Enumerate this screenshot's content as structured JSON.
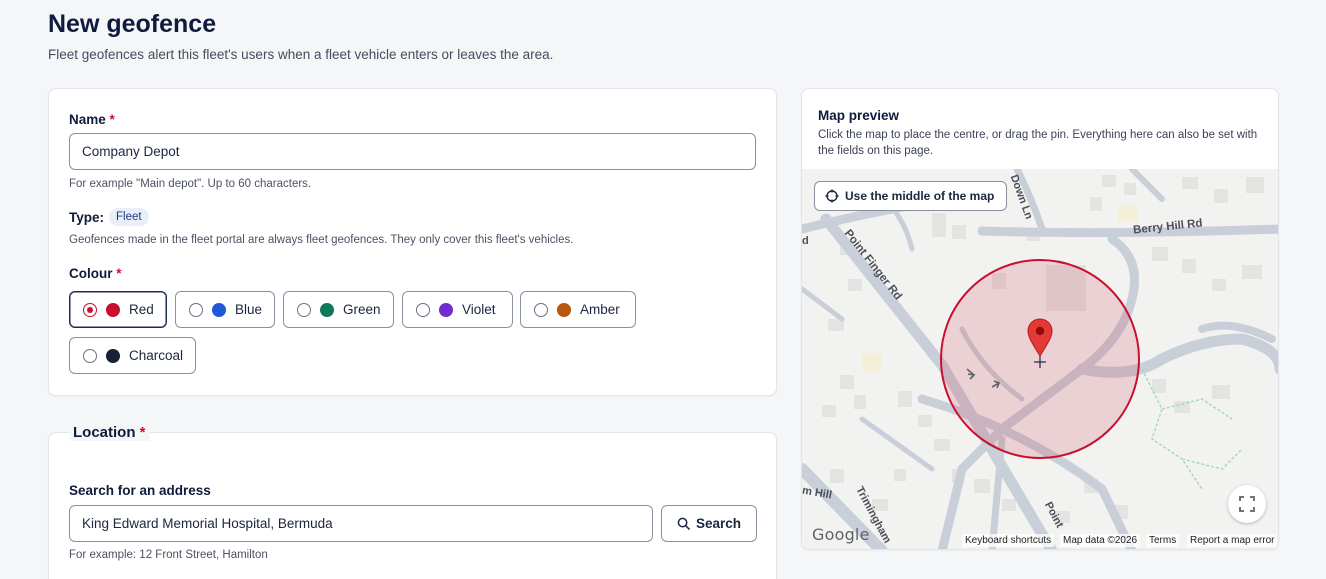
{
  "page": {
    "title": "New geofence",
    "subtitle": "Fleet geofences alert this fleet's users when a fleet vehicle enters or leaves the area."
  },
  "details": {
    "name_label": "Name",
    "required_mark": "*",
    "name_value": "Company Depot",
    "name_hint": "For example \"Main depot\". Up to 60 characters.",
    "type_label": "Type:",
    "type_badge": "Fleet",
    "type_hint": "Geofences made in the fleet portal are always fleet geofences. They only cover this fleet's vehicles.",
    "colour_label": "Colour",
    "colours": [
      {
        "label": "Red",
        "hex": "#c8102e",
        "selected": true
      },
      {
        "label": "Blue",
        "hex": "#1f5ad6",
        "selected": false
      },
      {
        "label": "Green",
        "hex": "#0e7a5a",
        "selected": false
      },
      {
        "label": "Violet",
        "hex": "#6f2fcf",
        "selected": false
      },
      {
        "label": "Amber",
        "hex": "#b85810",
        "selected": false
      },
      {
        "label": "Charcoal",
        "hex": "#182036",
        "selected": false
      }
    ]
  },
  "location": {
    "legend": "Location",
    "required_mark": "*",
    "search_label": "Search for an address",
    "search_value": "King Edward Memorial Hospital, Bermuda",
    "search_button": "Search",
    "search_hint": "For example: 12 Front Street, Hamilton"
  },
  "map": {
    "title": "Map preview",
    "description": "Click the map to place the centre, or drag the pin. Everything here can also be set with the fields on this page.",
    "use_middle_button": "Use the middle of the map",
    "street_labels": [
      "Berry Hill Rd",
      "Point Finger Rd",
      "Down Ln",
      "Trimingham",
      "Point",
      "m Hill",
      "d"
    ],
    "google_logo": "Google",
    "attribution": [
      "Keyboard shortcuts",
      "Map data ©2026",
      "Terms",
      "Report a map error"
    ],
    "fence_colour": "#c8102e"
  }
}
